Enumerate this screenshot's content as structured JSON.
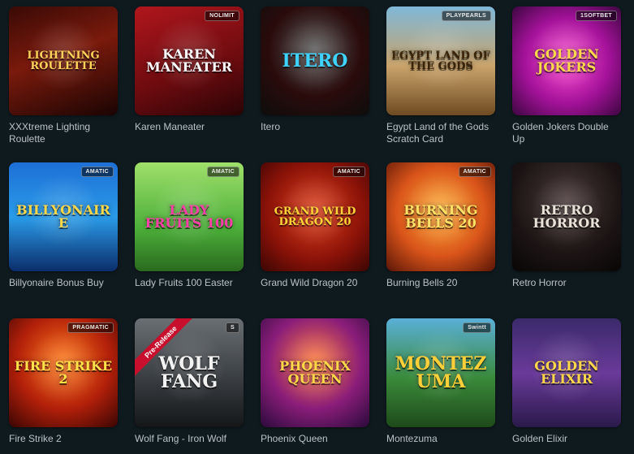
{
  "games": [
    {
      "title": "XXXtreme Lighting Roulette",
      "logo": "LIGHTNING ROULETTE",
      "badge": "",
      "ribbon": "",
      "bg": "linear-gradient(160deg,#3a0a06 0%,#7a1a0c 45%,#1a0403 100%)",
      "logo_color": "#ffd35a"
    },
    {
      "title": "Karen Maneater",
      "logo": "KAREN MANEATER",
      "badge": "NOLIMIT",
      "ribbon": "",
      "bg": "linear-gradient(160deg,#b0161c 0%,#6b0b0f 60%,#2a0406 100%)",
      "logo_color": "#ffffff"
    },
    {
      "title": "Itero",
      "logo": "ITERO",
      "badge": "",
      "ribbon": "",
      "bg": "radial-gradient(circle at 50% 40%,#5a5a5a 0%,#2a0b0b 55%,#0d0d0d 100%)",
      "logo_color": "#3fd2ff"
    },
    {
      "title": "Egypt Land of the Gods Scratch Card",
      "logo": "EGYPT LAND OF THE GODS",
      "badge": "PLAYPEARLS",
      "ribbon": "",
      "bg": "linear-gradient(180deg,#7fb8d9 0%,#c9a36a 55%,#6e4a22 100%)",
      "logo_color": "#3a2306"
    },
    {
      "title": "Golden Jokers Double Up",
      "logo": "GOLDEN JOKERS",
      "badge": "1SOFTBET",
      "ribbon": "",
      "bg": "radial-gradient(circle at 50% 50%,#ff4fd2 0%,#a4129a 55%,#3d0640 100%)",
      "logo_color": "#ffd84a"
    },
    {
      "title": "Billyonaire Bonus Buy",
      "logo": "BILLYONAIRE",
      "badge": "AMATIC",
      "ribbon": "",
      "bg": "linear-gradient(180deg,#1d6fd6 0%,#2a9be8 50%,#0b2d6b 100%)",
      "logo_color": "#ffd84a"
    },
    {
      "title": "Lady Fruits 100 Easter",
      "logo": "LADY FRUITS 100",
      "badge": "AMATIC",
      "ribbon": "",
      "bg": "linear-gradient(180deg,#9fe06a 0%,#4caf3a 60%,#2a6a1e 100%)",
      "logo_color": "#ff3ea8"
    },
    {
      "title": "Grand Wild Dragon 20",
      "logo": "GRAND WILD DRAGON 20",
      "badge": "AMATIC",
      "ribbon": "",
      "bg": "radial-gradient(circle at 50% 45%,#e0401c 0%,#8a1208 60%,#3a0604 100%)",
      "logo_color": "#ffd23a"
    },
    {
      "title": "Burning Bells 20",
      "logo": "BURNING BELLS 20",
      "badge": "AMATIC",
      "ribbon": "",
      "bg": "radial-gradient(circle at 50% 45%,#ffb13a 0%,#d9541a 55%,#5a1506 100%)",
      "logo_color": "#ffe066"
    },
    {
      "title": "Retro Horror",
      "logo": "RETRO HORROR",
      "badge": "",
      "ribbon": "",
      "bg": "radial-gradient(circle at 50% 35%,#4a3a3a 0%,#1c1414 60%,#080606 100%)",
      "logo_color": "#e8e2d8"
    },
    {
      "title": "Fire Strike 2",
      "logo": "FIRE STRIKE 2",
      "badge": "PRAGMATIC",
      "ribbon": "",
      "bg": "radial-gradient(circle at 50% 40%,#ff7a1a 0%,#b3200a 55%,#3a0503 100%)",
      "logo_color": "#ffe24a"
    },
    {
      "title": "Wolf Fang - Iron Wolf",
      "logo": "WOLF FANG",
      "badge": "S",
      "ribbon": "Pre-Release",
      "bg": "linear-gradient(180deg,#6a6f73 0%,#3a3e42 55%,#141618 100%)",
      "logo_color": "#f2f2f2"
    },
    {
      "title": "Phoenix Queen",
      "logo": "PHOENIX QUEEN",
      "badge": "",
      "ribbon": "",
      "bg": "radial-gradient(circle at 50% 40%,#ff7a3a 0%,#8a1d7a 55%,#2a0a3a 100%)",
      "logo_color": "#ffd84a"
    },
    {
      "title": "Montezuma",
      "logo": "MONTEZUMA",
      "badge": "Swintt",
      "ribbon": "",
      "bg": "linear-gradient(180deg,#5ab0d8 0%,#3a8a3a 55%,#1e4a1a 100%)",
      "logo_color": "#ffcf3a"
    },
    {
      "title": "Golden Elixir",
      "logo": "GOLDEN ELIXIR",
      "badge": "",
      "ribbon": "",
      "bg": "linear-gradient(180deg,#3a2a6a 0%,#6a3a9a 50%,#2a1a4a 100%)",
      "logo_color": "#ffd84a"
    }
  ]
}
